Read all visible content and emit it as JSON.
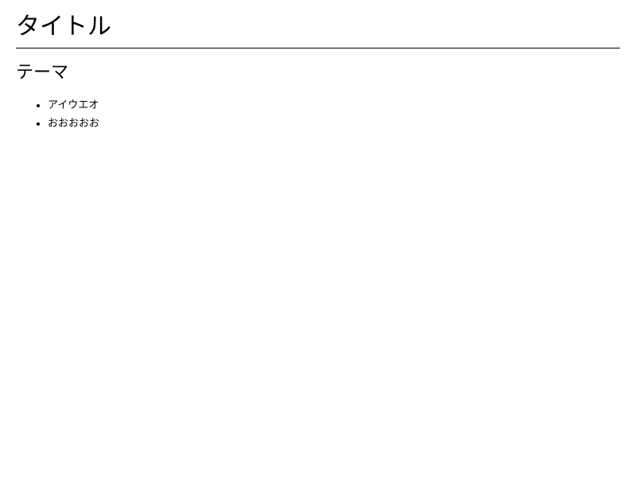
{
  "page": {
    "title": "タイトル",
    "section": {
      "heading": "テーマ",
      "items": [
        "アイウエオ",
        "おおおおお"
      ]
    }
  }
}
